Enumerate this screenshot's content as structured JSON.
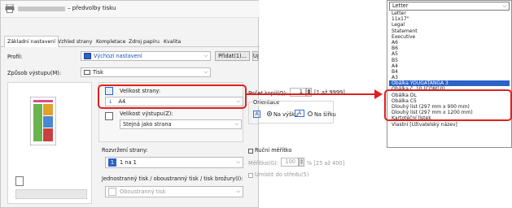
{
  "dialog": {
    "title": "– předvolby tisku",
    "tabs": [
      {
        "label": "Základní nastavení",
        "active": true
      },
      {
        "label": "Vzhled strany"
      },
      {
        "label": "Kompletace"
      },
      {
        "label": "Zdroj papíru"
      },
      {
        "label": "Kvalita"
      }
    ],
    "profile": {
      "label": "Profil:",
      "value": "Výchozí nastavení",
      "add_button": "Přidat(1)...",
      "edit_button": "Upravit(2)..."
    },
    "output": {
      "label": "Způsob výstupu(M):",
      "value": "Tisk"
    },
    "page_size": {
      "label": "Velikost strany:",
      "value": "A4"
    },
    "output_size": {
      "label": "Velikost výstupu(Z):",
      "value": "Stejná jako strana"
    },
    "copies": {
      "label": "Počet kopií(Q):",
      "value": "1",
      "range": "[1 až 9999]"
    },
    "orientation": {
      "label": "Orientace",
      "portrait": "Na výšku",
      "landscape": "Na šířku",
      "selected": "portrait"
    },
    "layout": {
      "label": "Rozvržení strany:",
      "value": "1 na 1"
    },
    "manual_scale": {
      "label": "Ruční měřítko",
      "scale_label": "Měřítko(G):",
      "scale_value": "100",
      "scale_range": "% [25 až 400]",
      "center_label": "Umístit do středu(5)"
    },
    "duplex": {
      "label": "Jednostranný tisk / oboustranný tisk / tisk brožury(I):",
      "value": "Oboustranný tisk"
    }
  },
  "dropdown": {
    "selected_value": "Letter",
    "options": [
      {
        "label": "Letter"
      },
      {
        "label": "11x17\""
      },
      {
        "label": "Legal"
      },
      {
        "label": "Statement"
      },
      {
        "label": "Executive"
      },
      {
        "label": "A6"
      },
      {
        "label": "B6"
      },
      {
        "label": "A5"
      },
      {
        "label": "B5"
      },
      {
        "label": "A4"
      },
      {
        "label": "B4"
      },
      {
        "label": "A3"
      },
      {
        "label": "Obálka YOUGATANGA 3",
        "selected": true
      },
      {
        "label": "Obálka č. 10 (COM10)"
      },
      {
        "label": "Obálka DL"
      },
      {
        "label": "Obálka C5"
      },
      {
        "label": "Dlouhý list (297 mm x 900 mm)"
      },
      {
        "label": "Dlouhý list (297 mm x 1200 mm)"
      },
      {
        "label": "Kartotéční lístek"
      },
      {
        "label": "Vlastní [Uživatelský název]"
      }
    ]
  },
  "colors": {
    "accent": "#2b62c8",
    "highlight": "#e0201e"
  }
}
